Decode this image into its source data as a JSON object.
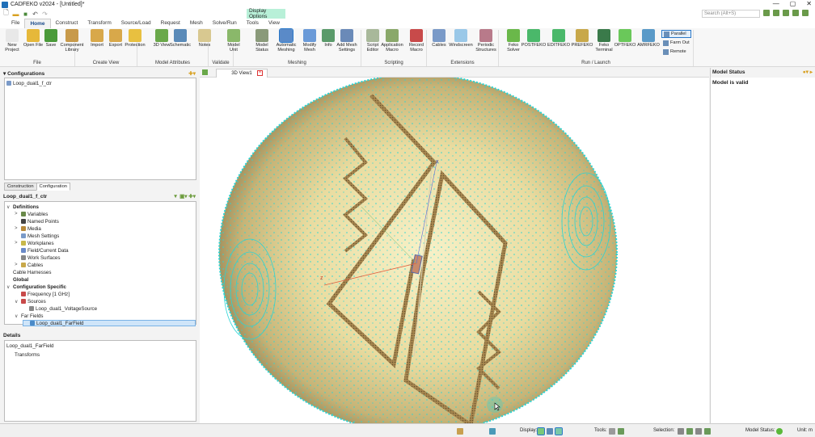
{
  "app": {
    "title": "CADFEKO v2024 - [Untitled]*"
  },
  "window_controls": {
    "minimize": "—",
    "maximize": "▢",
    "close": "✕"
  },
  "context_tab": "Display Options",
  "search": {
    "placeholder": "Search (Alt+S)"
  },
  "menu_tabs": [
    "File",
    "Home",
    "Construct",
    "Transform",
    "Source/Load",
    "Request",
    "Mesh",
    "Solve/Run",
    "Tools",
    "View"
  ],
  "ribbon": {
    "groups": [
      {
        "label": "File"
      },
      {
        "label": "Create View"
      },
      {
        "label": "Model Attributes"
      },
      {
        "label": "Validate"
      },
      {
        "label": "Meshing"
      },
      {
        "label": "Scripting"
      },
      {
        "label": "Extensions"
      },
      {
        "label": "Run / Launch"
      }
    ],
    "buttons": [
      {
        "label": "New Project",
        "icon": "new-project-icon",
        "color": "#e8e8e8"
      },
      {
        "label": "Open File",
        "icon": "open-file-icon",
        "color": "#e6b83a"
      },
      {
        "label": "Save",
        "icon": "save-icon",
        "color": "#4a9a3a"
      },
      {
        "label": "Component Library",
        "icon": "component-library-icon",
        "color": "#c89a4a"
      },
      {
        "label": "Import",
        "icon": "import-icon",
        "color": "#d8a84a"
      },
      {
        "label": "Export",
        "icon": "export-icon",
        "color": "#d8a84a"
      },
      {
        "label": "Protection",
        "icon": "protection-icon",
        "color": "#e8c040"
      },
      {
        "label": "3D View",
        "icon": "3d-view-icon",
        "color": "#6aa84a"
      },
      {
        "label": "Schematic",
        "icon": "schematic-icon",
        "color": "#5a8ab8"
      },
      {
        "label": "Notes",
        "icon": "notes-icon",
        "color": "#d8c890"
      },
      {
        "label": "Model Unit",
        "icon": "model-unit-icon",
        "color": "#8ab86a"
      },
      {
        "label": "Model Status",
        "icon": "model-status-icon",
        "color": "#8a9a7a"
      },
      {
        "label": "Automatic Meshing",
        "icon": "automatic-meshing-icon",
        "color": "#5a8ac8"
      },
      {
        "label": "Modify Mesh",
        "icon": "modify-mesh-icon",
        "color": "#6a9ad8"
      },
      {
        "label": "Info",
        "icon": "info-icon",
        "color": "#5a9a6a"
      },
      {
        "label": "Add Mesh Settings",
        "icon": "add-mesh-settings-icon",
        "color": "#6a8ab8"
      },
      {
        "label": "Script Editor",
        "icon": "script-editor-icon",
        "color": "#a8b89a"
      },
      {
        "label": "Application Macro",
        "icon": "application-macro-icon",
        "color": "#8aa86a"
      },
      {
        "label": "Record Macro",
        "icon": "record-macro-icon",
        "color": "#c84a4a"
      },
      {
        "label": "Cables",
        "icon": "cables-icon",
        "color": "#7a9ac8"
      },
      {
        "label": "Windscreen",
        "icon": "windscreen-icon",
        "color": "#9ac8e8"
      },
      {
        "label": "Periodic Structures",
        "icon": "periodic-structures-icon",
        "color": "#b87a8a"
      },
      {
        "label": "Feko Solver",
        "icon": "feko-solver-icon",
        "color": "#6ab84a"
      },
      {
        "label": "POSTFEKO",
        "icon": "postfeko-icon",
        "color": "#4ab86a"
      },
      {
        "label": "EDITFEKO",
        "icon": "editfeko-icon",
        "color": "#4ab86a"
      },
      {
        "label": "PREFEKO",
        "icon": "prefeko-icon",
        "color": "#c8a84a"
      },
      {
        "label": "Feko Terminal",
        "icon": "feko-terminal-icon",
        "color": "#3a7a4a"
      },
      {
        "label": "OPTFEKO",
        "icon": "optfeko-icon",
        "color": "#6ac85a"
      },
      {
        "label": "AMRFEKO",
        "icon": "amrfeko-icon",
        "color": "#5a9ac8"
      }
    ],
    "small_buttons": [
      "Parallel",
      "Farm Out",
      "Remote"
    ]
  },
  "configurations_panel": {
    "title": "Configurations",
    "item": "Loop_dual1_f_ctr"
  },
  "panel_tabs": [
    "Construction",
    "Configuration"
  ],
  "tree": {
    "root_label": "Loop_dual1_f_ctr",
    "items": [
      {
        "label": "Definitions",
        "bold": true,
        "indent": 0,
        "exp": "∨",
        "color": ""
      },
      {
        "label": "Variables",
        "indent": 1,
        "exp": ">",
        "color": "#6a8a4a"
      },
      {
        "label": "Named Points",
        "indent": 1,
        "exp": "",
        "color": "#444"
      },
      {
        "label": "Media",
        "indent": 1,
        "exp": ">",
        "color": "#b88a3a"
      },
      {
        "label": "Mesh Settings",
        "indent": 1,
        "exp": "",
        "color": "#7a9ac8"
      },
      {
        "label": "Workplanes",
        "indent": 1,
        "exp": ">",
        "color": "#c8b84a"
      },
      {
        "label": "Field/Current Data",
        "indent": 1,
        "exp": "",
        "color": "#6a8ac8"
      },
      {
        "label": "Work Surfaces",
        "indent": 1,
        "exp": "",
        "color": "#888"
      },
      {
        "label": "Cables",
        "indent": 1,
        "exp": ">",
        "color": "#c8a84a"
      },
      {
        "label": "Cable Harnesses",
        "indent": 0,
        "exp": "",
        "color": ""
      },
      {
        "label": "Global",
        "bold": true,
        "indent": 0,
        "exp": "",
        "color": ""
      },
      {
        "label": "Configuration Specific",
        "bold": true,
        "indent": 0,
        "exp": "∨",
        "color": ""
      },
      {
        "label": "Frequency [1 GHz]",
        "indent": 1,
        "exp": "",
        "color": "#c84a4a"
      },
      {
        "label": "Sources",
        "indent": 1,
        "exp": "∨",
        "color": "#c84a4a"
      },
      {
        "label": "Loop_dual1_VoltageSource",
        "indent": 2,
        "exp": "",
        "color": "#888"
      },
      {
        "label": "Far Fields",
        "indent": 1,
        "exp": "∨",
        "color": ""
      },
      {
        "label": "Loop_dual1_FarField",
        "indent": 2,
        "exp": "",
        "color": "#4a8ac8",
        "selected": true
      }
    ]
  },
  "details": {
    "title": "Details",
    "item": "Loop_dual1_FarField",
    "sub": "Transforms"
  },
  "view": {
    "tab_label": "3D View1",
    "axis_x": "x",
    "axis_z": "z"
  },
  "model_status": {
    "title": "Model Status",
    "message": "Model is valid"
  },
  "statusbar": {
    "display": "Display:",
    "tools": "Tools:",
    "selection": "Selection:",
    "model_status": "Model Status:",
    "unit": "Unit: m"
  },
  "colors": {
    "sphere_light": "#f6efc4",
    "sphere_dark": "#9a8a52",
    "mesh_dot": "#2ad4d4",
    "trace": "#8a6a3a"
  }
}
